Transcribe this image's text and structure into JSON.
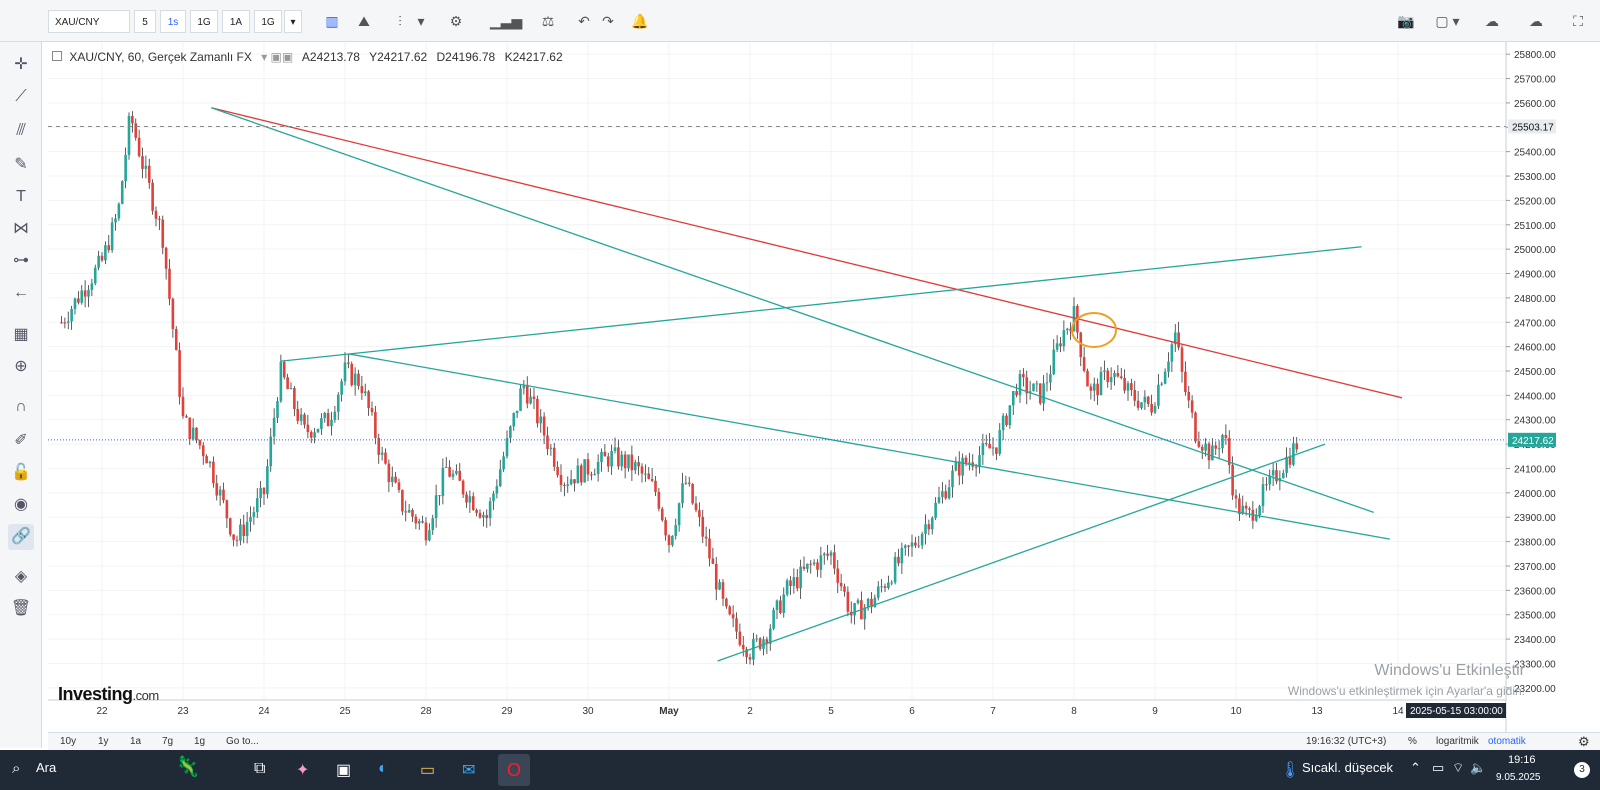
{
  "toolbar": {
    "symbol": "XAU/CNY",
    "intervals": [
      "5",
      "1s",
      "1G",
      "1A",
      "1G"
    ],
    "active_interval": "1s"
  },
  "legend": {
    "title": "XAU/CNY, 60, Gerçek Zamanlı FX",
    "open": "A24213.78",
    "high": "Y24217.62",
    "low": "D24196.78",
    "close": "K24217.62"
  },
  "price_tags": {
    "dashed_level": "25503.17",
    "current_price": "24217.62",
    "time_tag": "2025-05-15 03:00:00"
  },
  "bottom_bar": {
    "ranges": [
      "10y",
      "1y",
      "1a",
      "7g",
      "1g"
    ],
    "goto": "Go to...",
    "clock": "19:16:32 (UTC+3)",
    "percent": "%",
    "log": "logaritmik",
    "auto": "otomatik"
  },
  "watermark": {
    "title": "Windows'u Etkinleştir",
    "subtitle": "Windows'u etkinleştirmek için Ayarlar'a gidin."
  },
  "logo": {
    "name": "Investing",
    "suffix": ".com"
  },
  "taskbar": {
    "search": "Ara",
    "weather": "Sıcakl. düşecek",
    "time": "19:16",
    "date": "9.05.2025",
    "badge": "3"
  },
  "chart_data": {
    "type": "candlestick",
    "y_ticks": [
      "25800.00",
      "25700.00",
      "25600.00",
      "25500.00",
      "25400.00",
      "25300.00",
      "25200.00",
      "25100.00",
      "25000.00",
      "24900.00",
      "24800.00",
      "24700.00",
      "24600.00",
      "24500.00",
      "24400.00",
      "24300.00",
      "24200.00",
      "24100.00",
      "24000.00",
      "23900.00",
      "23800.00",
      "23700.00",
      "23600.00",
      "23500.00",
      "23400.00",
      "23300.00",
      "23200.00"
    ],
    "x_ticks": [
      "22",
      "23",
      "24",
      "25",
      "28",
      "29",
      "30",
      "May",
      "2",
      "5",
      "6",
      "7",
      "8",
      "9",
      "10",
      "13",
      "14"
    ],
    "ylim": [
      23150,
      25850
    ],
    "current_price": 24217.62,
    "dashed_level": 25503.17,
    "trendlines": [
      {
        "color": "#e03a3a",
        "from": [
          1.35,
          25580
        ],
        "to": [
          16.05,
          24390
        ]
      },
      {
        "color": "#26a69a",
        "from": [
          1.35,
          25580
        ],
        "to": [
          15.7,
          23920
        ]
      },
      {
        "color": "#26a69a",
        "from": [
          2.2,
          24540
        ],
        "to": [
          15.55,
          25010
        ]
      },
      {
        "color": "#26a69a",
        "from": [
          3.05,
          24570
        ],
        "to": [
          15.9,
          23810
        ]
      },
      {
        "color": "#26a69a",
        "from": [
          7.6,
          23310
        ],
        "to": [
          15.1,
          24200
        ]
      }
    ],
    "path": [
      [
        -0.5,
        24700
      ],
      [
        0.0,
        24950
      ],
      [
        0.2,
        25150
      ],
      [
        0.35,
        25550
      ],
      [
        0.5,
        25350
      ],
      [
        0.75,
        25050
      ],
      [
        1.0,
        24300
      ],
      [
        1.3,
        24150
      ],
      [
        1.65,
        23800
      ],
      [
        2.0,
        24000
      ],
      [
        2.2,
        24500
      ],
      [
        2.5,
        24250
      ],
      [
        2.8,
        24300
      ],
      [
        3.0,
        24500
      ],
      [
        3.2,
        24450
      ],
      [
        3.45,
        24150
      ],
      [
        3.7,
        23950
      ],
      [
        4.0,
        23850
      ],
      [
        4.25,
        24100
      ],
      [
        4.5,
        24000
      ],
      [
        4.75,
        23900
      ],
      [
        5.0,
        24200
      ],
      [
        5.2,
        24450
      ],
      [
        5.45,
        24250
      ],
      [
        5.7,
        24050
      ],
      [
        6.0,
        24100
      ],
      [
        6.3,
        24150
      ],
      [
        6.6,
        24100
      ],
      [
        6.85,
        24000
      ],
      [
        7.0,
        23800
      ],
      [
        7.2,
        24050
      ],
      [
        7.45,
        23800
      ],
      [
        7.7,
        23500
      ],
      [
        8.0,
        23350
      ],
      [
        8.2,
        23420
      ],
      [
        8.45,
        23600
      ],
      [
        8.75,
        23700
      ],
      [
        9.0,
        23750
      ],
      [
        9.25,
        23500
      ],
      [
        9.5,
        23550
      ],
      [
        9.8,
        23700
      ],
      [
        10.05,
        23800
      ],
      [
        10.3,
        23950
      ],
      [
        10.55,
        24100
      ],
      [
        10.8,
        24150
      ],
      [
        11.05,
        24200
      ],
      [
        11.3,
        24450
      ],
      [
        11.6,
        24400
      ],
      [
        11.85,
        24650
      ],
      [
        12.0,
        24730
      ],
      [
        12.2,
        24400
      ],
      [
        12.45,
        24500
      ],
      [
        12.7,
        24400
      ],
      [
        12.95,
        24350
      ],
      [
        13.15,
        24550
      ],
      [
        13.25,
        24650
      ],
      [
        13.35,
        24450
      ],
      [
        13.5,
        24250
      ],
      [
        13.7,
        24150
      ],
      [
        13.85,
        24250
      ],
      [
        14.0,
        23950
      ],
      [
        14.15,
        23900
      ],
      [
        14.35,
        24000
      ],
      [
        14.55,
        24100
      ],
      [
        14.75,
        24200
      ]
    ]
  }
}
